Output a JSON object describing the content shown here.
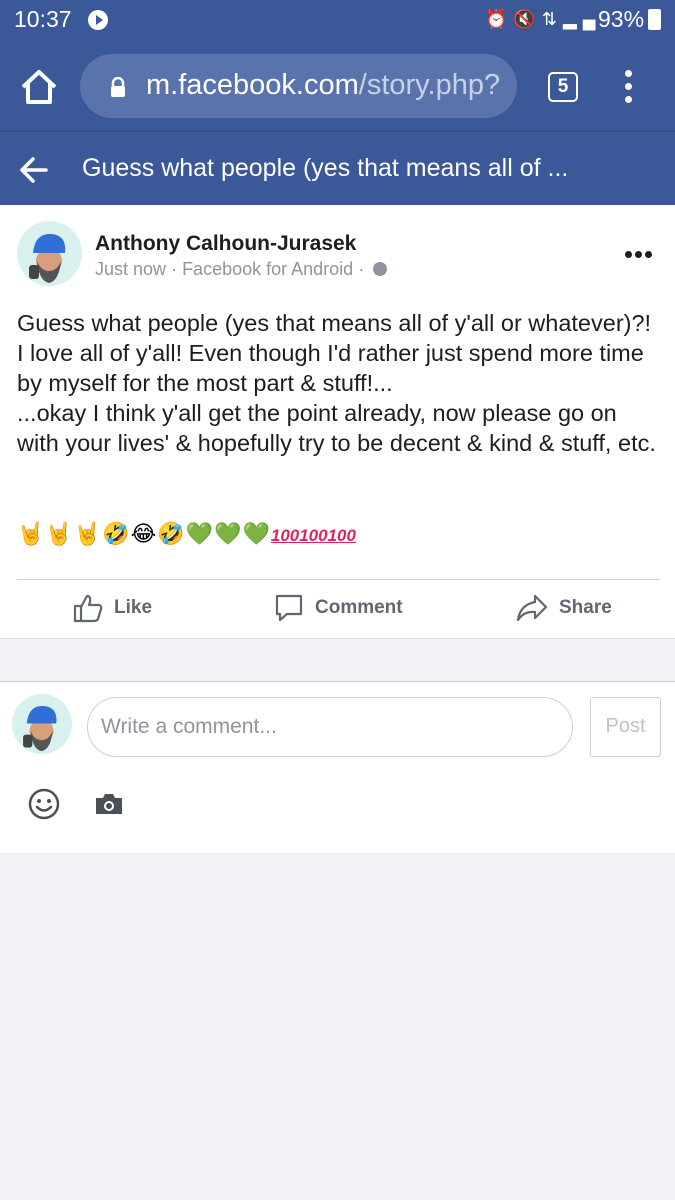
{
  "status_bar": {
    "time": "10:37",
    "battery": "93%"
  },
  "browser": {
    "url_domain": "m.facebook.com",
    "url_path": "/story.php?",
    "tab_count": "5"
  },
  "nav": {
    "title": "Guess what people (yes that means all of ..."
  },
  "post": {
    "author": "Anthony Calhoun-Jurasek",
    "timestamp": "Just now",
    "source": "Facebook for Android",
    "paragraphs": [
      "Guess what people (yes that means all of y'all or whatever)?!",
      "I love all of y'all! Even though I'd rather just spend more time by myself for the most part & stuff!...",
      "...okay I think y'all get the point already, now please go on with your lives' & hopefully try to be decent & kind & stuff, etc."
    ],
    "emojis": "🤘🤘🤘🤣😂🤣💚💚💚",
    "hundreds": "100100100"
  },
  "actions": {
    "like": "Like",
    "comment": "Comment",
    "share": "Share"
  },
  "comment_box": {
    "placeholder": "Write a comment...",
    "post_label": "Post"
  },
  "colors": {
    "brand": "#3b5998",
    "url_bar": "#5a73ad",
    "page_bg": "#f0f2f5",
    "action_text": "#606770",
    "hundred_red": "#e0245e"
  },
  "icons": [
    "play-icon",
    "alarm-icon",
    "mute-icon",
    "data-icon",
    "signal-icon",
    "battery-icon",
    "home-icon",
    "lock-icon",
    "tabs-icon",
    "menu-icon",
    "back-arrow-icon",
    "globe-icon",
    "more-icon",
    "like-icon",
    "comment-icon",
    "share-icon",
    "smiley-icon",
    "camera-icon"
  ]
}
